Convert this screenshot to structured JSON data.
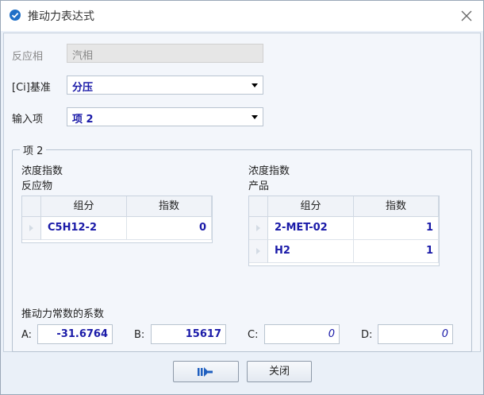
{
  "window": {
    "title": "推动力表达式"
  },
  "form": {
    "phase_label": "反应相",
    "phase_value": "汽相",
    "basis_label": "[Ci]基准",
    "basis_value": "分压",
    "input_label": "输入项",
    "input_value": "项 2"
  },
  "group": {
    "title": "项 2",
    "reactants": {
      "heading1": "浓度指数",
      "heading2": "反应物",
      "columns": [
        "组分",
        "指数"
      ],
      "rows": [
        {
          "component": "C5H12-2",
          "exponent": "0"
        }
      ]
    },
    "products": {
      "heading1": "浓度指数",
      "heading2": "产品",
      "columns": [
        "组分",
        "指数"
      ],
      "rows": [
        {
          "component": "2-MET-02",
          "exponent": "1"
        },
        {
          "component": "H2",
          "exponent": "1"
        }
      ]
    },
    "coef_title": "推动力常数的系数",
    "coefs": [
      {
        "label": "A:",
        "value": "-31.6764"
      },
      {
        "label": "B:",
        "value": "15617"
      },
      {
        "label": "C:",
        "value": "0"
      },
      {
        "label": "D:",
        "value": "0"
      }
    ]
  },
  "buttons": {
    "next_icon": "arrow-next-icon",
    "close_label": "关闭"
  }
}
